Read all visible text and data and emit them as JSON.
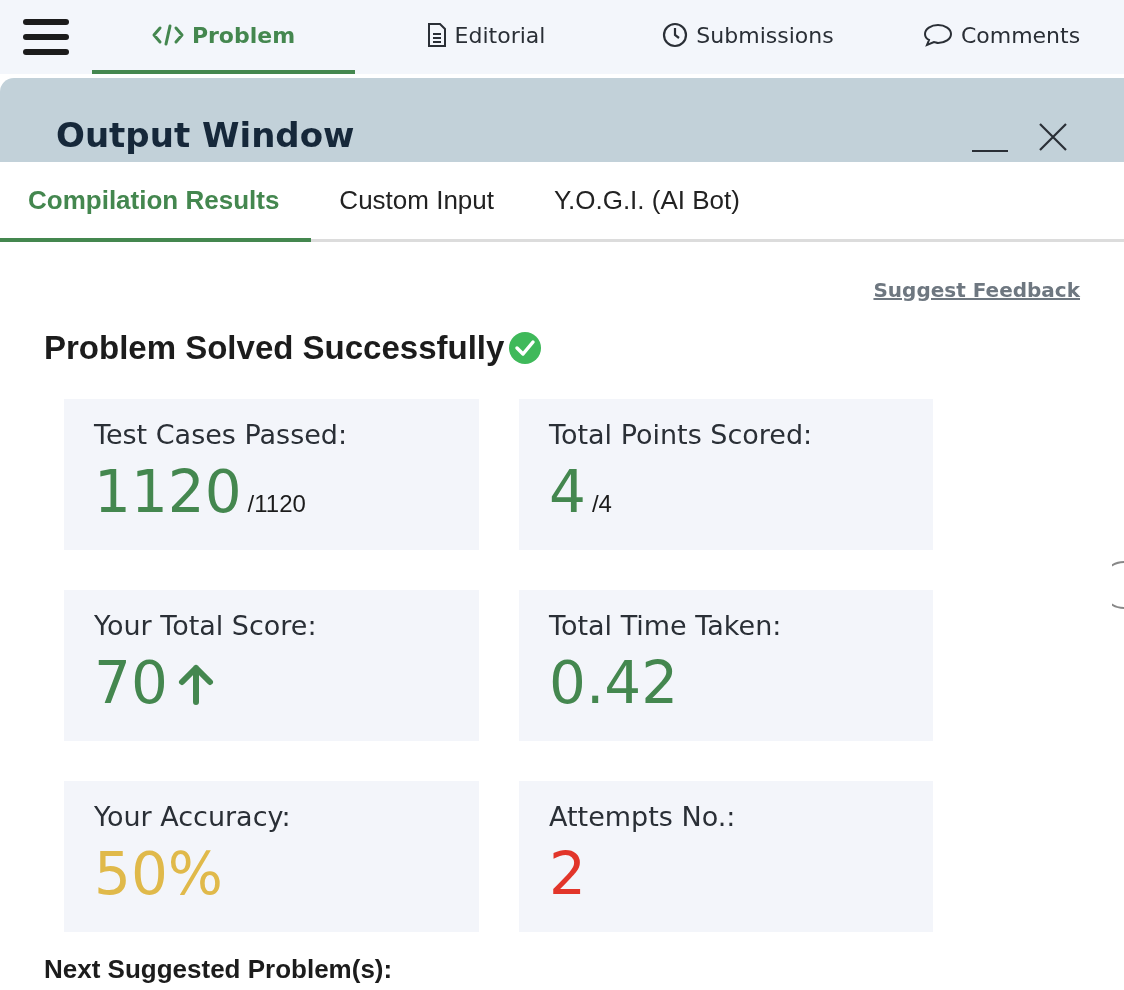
{
  "nav_tabs": [
    {
      "label": "Problem",
      "kind": "code",
      "selected": true
    },
    {
      "label": "Editorial",
      "kind": "document",
      "selected": false
    },
    {
      "label": "Submissions",
      "kind": "clock",
      "selected": false
    },
    {
      "label": "Comments",
      "kind": "speech",
      "selected": false
    }
  ],
  "output_window": {
    "title": "Output Window",
    "tabs": [
      {
        "label": "Compilation Results",
        "selected": true
      },
      {
        "label": "Custom Input",
        "selected": false
      },
      {
        "label": "Y.O.G.I. (AI Bot)",
        "selected": false
      }
    ],
    "feedback_link": "Suggest Feedback",
    "status": {
      "text": "Problem Solved Successfully",
      "success": true
    },
    "stats": [
      {
        "label": "Test Cases Passed:",
        "value": "1120",
        "total": "/1120",
        "color": "#44874f"
      },
      {
        "label": "Total Points Scored:",
        "value": "4",
        "total": "/4",
        "color": "#44874f"
      },
      {
        "label": "Your Total Score:",
        "value": "70",
        "rising": true,
        "color": "#44874f"
      },
      {
        "label": "Total Time Taken:",
        "value": "0.42",
        "color": "#44874f"
      },
      {
        "label": "Your Accuracy:",
        "value": "50%",
        "color": "#e0b94a"
      },
      {
        "label": "Attempts No.:",
        "value": "2",
        "color": "#e2352a"
      }
    ],
    "next_heading": "Next Suggested Problem(s):"
  }
}
